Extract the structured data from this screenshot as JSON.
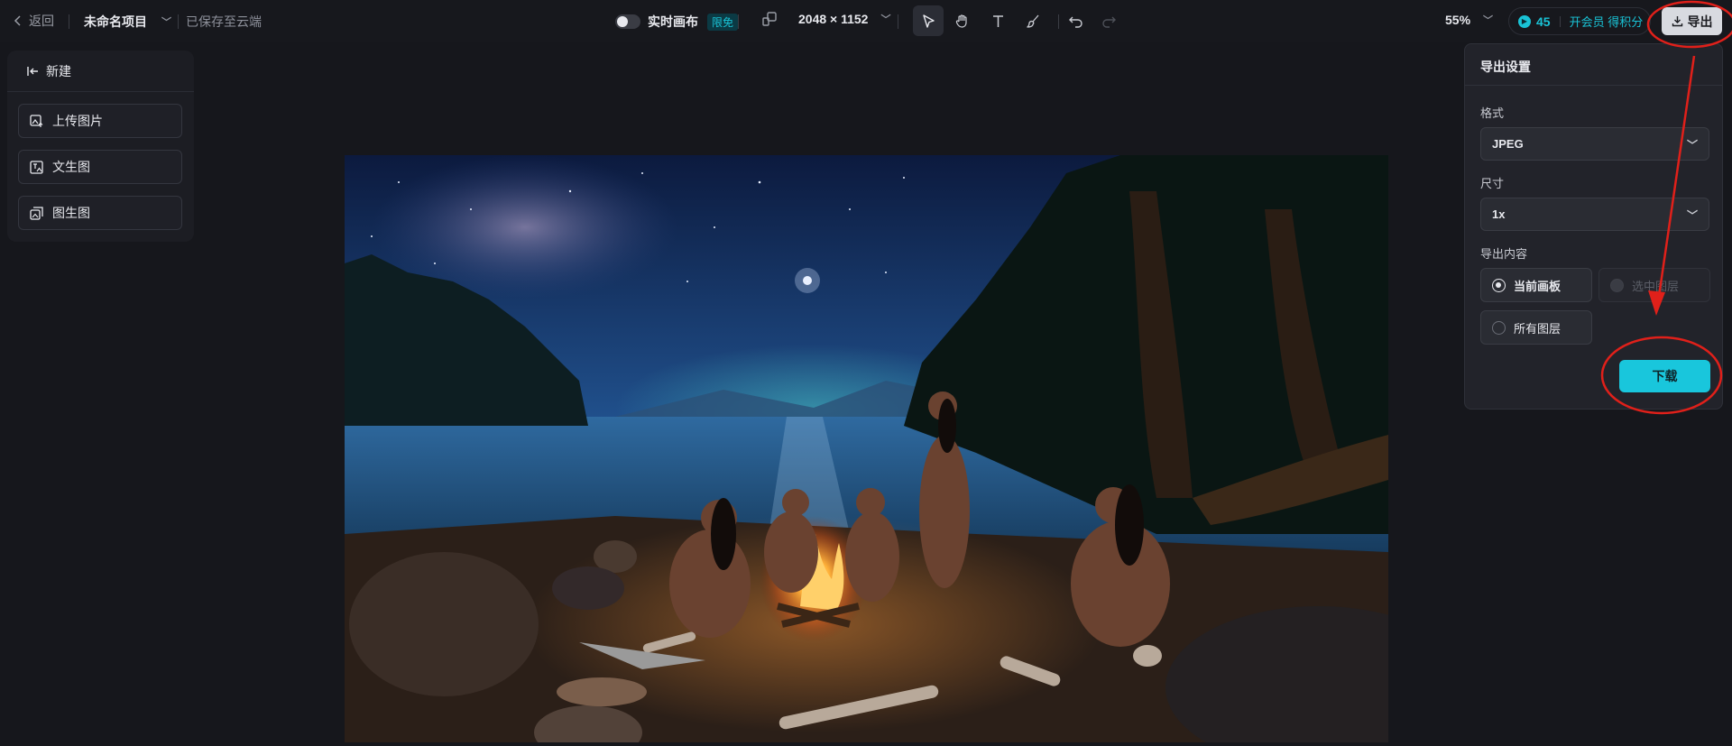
{
  "topbar": {
    "back_label": "返回",
    "project_name": "未命名项目",
    "saved_status": "已保存至云端",
    "realtime_canvas_label": "实时画布",
    "free_badge": "限免",
    "canvas_size": "2048 × 1152",
    "zoom": "55%",
    "points": "45",
    "points_link": "开会员 得积分",
    "export_label": "导出"
  },
  "sidebar": {
    "new_label": "新建",
    "items": [
      {
        "label": "上传图片",
        "icon": "upload-image-icon"
      },
      {
        "label": "文生图",
        "icon": "text-to-image-icon"
      },
      {
        "label": "图生图",
        "icon": "image-to-image-icon"
      }
    ]
  },
  "export_panel": {
    "title": "导出设置",
    "format_label": "格式",
    "format_value": "JPEG",
    "size_label": "尺寸",
    "size_value": "1x",
    "content_label": "导出内容",
    "options": [
      {
        "label": "当前画板",
        "state": "selected"
      },
      {
        "label": "选中图层",
        "state": "disabled"
      },
      {
        "label": "所有图层",
        "state": "unselected"
      }
    ],
    "download_label": "下载"
  },
  "colors": {
    "accent": "#19c6dc",
    "annotation": "#e0201a",
    "background": "#16171c"
  }
}
